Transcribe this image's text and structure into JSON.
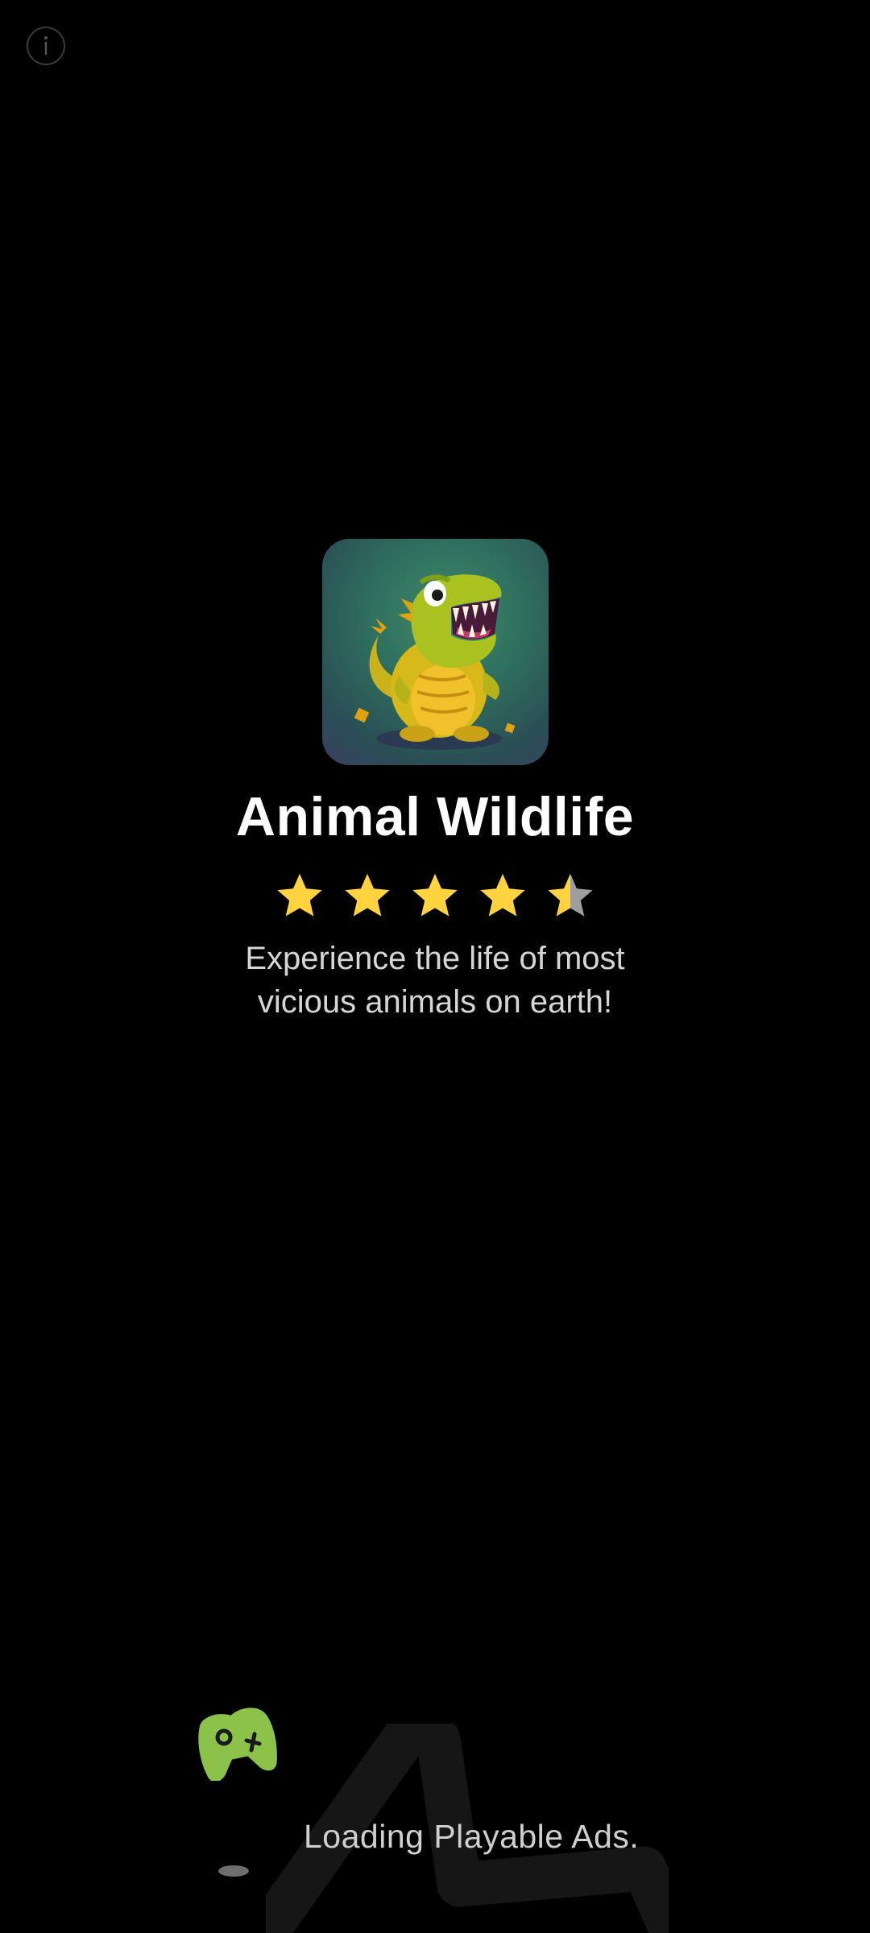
{
  "app": {
    "title": "Animal Wildlife",
    "description": "Experience the life of most vicious animals on earth!",
    "rating": 4.5,
    "rating_max": 5,
    "icon": "crocodile-app-icon"
  },
  "loader": {
    "text": "Loading Playable Ads.",
    "icon": "gamepad-icon"
  },
  "header": {
    "info_icon": "info-icon"
  },
  "colors": {
    "background": "#000000",
    "star_filled": "#FFD23F",
    "star_empty": "#9E9E9E",
    "gamepad": "#8BC34A",
    "title_text": "#FFFFFF",
    "description_text": "#D6D6D6"
  }
}
